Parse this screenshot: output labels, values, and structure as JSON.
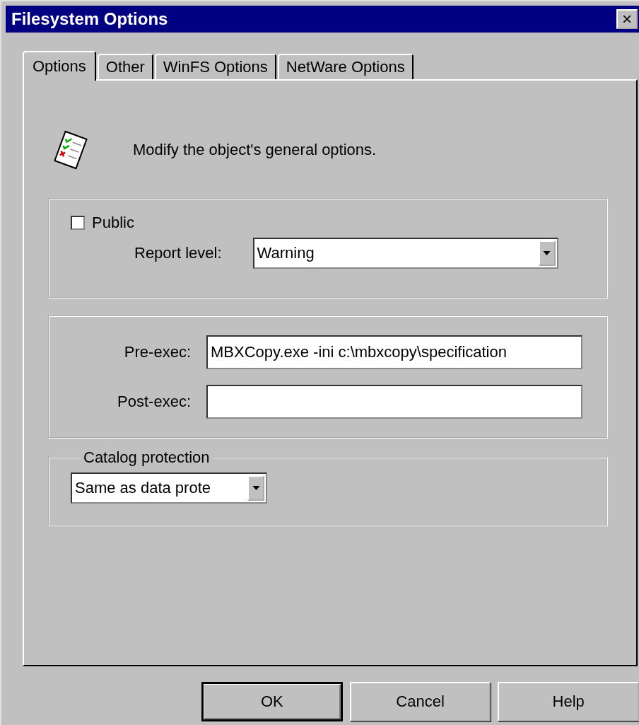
{
  "window": {
    "title": "Filesystem Options",
    "close": "×"
  },
  "tabs": [
    {
      "label": "Options",
      "selected": true
    },
    {
      "label": "Other",
      "selected": false
    },
    {
      "label": "WinFS Options",
      "selected": false
    },
    {
      "label": "NetWare Options",
      "selected": false
    }
  ],
  "description": "Modify the object's general options.",
  "general": {
    "public": {
      "label": "Public",
      "checked": false
    },
    "report_level": {
      "label": "Report level:",
      "value": "Warning"
    }
  },
  "exec": [
    {
      "label": "Pre-exec:",
      "value": "MBXCopy.exe -ini c:\\mbxcopy\\specification"
    },
    {
      "label": "Post-exec:"
    }
  ],
  "catalog_protection": {
    "legend": "Catalog protection",
    "value": "Same as data prote"
  },
  "buttons": [
    {
      "label": "OK",
      "default": true
    },
    {
      "label": "Cancel",
      "default": false
    },
    {
      "label": "Help",
      "default": false
    }
  ]
}
